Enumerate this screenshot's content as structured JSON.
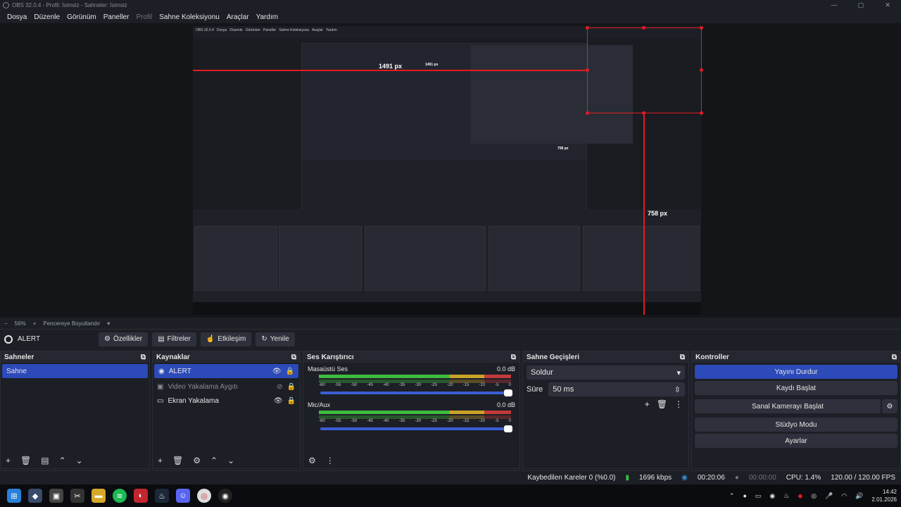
{
  "titlebar": {
    "title": "OBS 32.0.4 - Profil: İsimsiz - Sahneler: İsimsiz"
  },
  "menu": [
    "Dosya",
    "Düzenle",
    "Görünüm",
    "Paneller",
    "Profil",
    "Sahne Koleksiyonu",
    "Araçlar",
    "Yardım"
  ],
  "preview_annotations": {
    "width_label": "1491 px",
    "height_label": "758 px",
    "inner_width_label": "1491 px",
    "inner_height_label": "758 px"
  },
  "zoom": {
    "minus": "−",
    "value": "56%",
    "plus": "+",
    "mode": "Pencereye Boyutlandır"
  },
  "source_bar": {
    "name": "ALERT",
    "properties": "Özellikler",
    "filters": "Filtreler",
    "interact": "Etkileşim",
    "refresh": "Yenile"
  },
  "scenes": {
    "title": "Sahneler",
    "items": [
      "Sahne"
    ]
  },
  "sources": {
    "title": "Kaynaklar",
    "items": [
      "ALERT",
      "Video Yakalama Aygıtı",
      "Ekran Yakalama"
    ]
  },
  "mixer": {
    "title": "Ses Karıştırıcı",
    "ticks": [
      "-60",
      "-55",
      "-50",
      "-45",
      "-40",
      "-35",
      "-30",
      "-25",
      "-20",
      "-15",
      "-10",
      "-5",
      "0"
    ],
    "tracks": [
      {
        "name": "Masaüstü Ses",
        "db": "0.0 dB",
        "level": 0.45
      },
      {
        "name": "Mic/Aux",
        "db": "0.0 dB",
        "level": 0.3
      }
    ]
  },
  "transitions": {
    "title": "Sahne Geçişleri",
    "type": "Soldur",
    "duration_label": "Süre",
    "duration": "50 ms"
  },
  "controls": {
    "title": "Kontroller",
    "stop_stream": "Yayını Durdur",
    "start_record": "Kaydı Başlat",
    "virtual_cam": "Sanal Kamerayı Başlat",
    "studio": "Stüdyo Modu",
    "settings": "Ayarlar"
  },
  "status": {
    "dropped": "Kaybedilen Kareler 0 (%0.0)",
    "bitrate": "1696 kbps",
    "stream_time": "00:20:06",
    "rec_time": "00:00:00",
    "cpu": "CPU: 1.4%",
    "fps": "120.00 / 120.00 FPS"
  },
  "taskbar": {
    "time": "14:42",
    "date": "2.01.2026"
  },
  "colors": {
    "accent": "#2c4ab8",
    "panel": "#1d1f26",
    "red": "#e21b24"
  }
}
